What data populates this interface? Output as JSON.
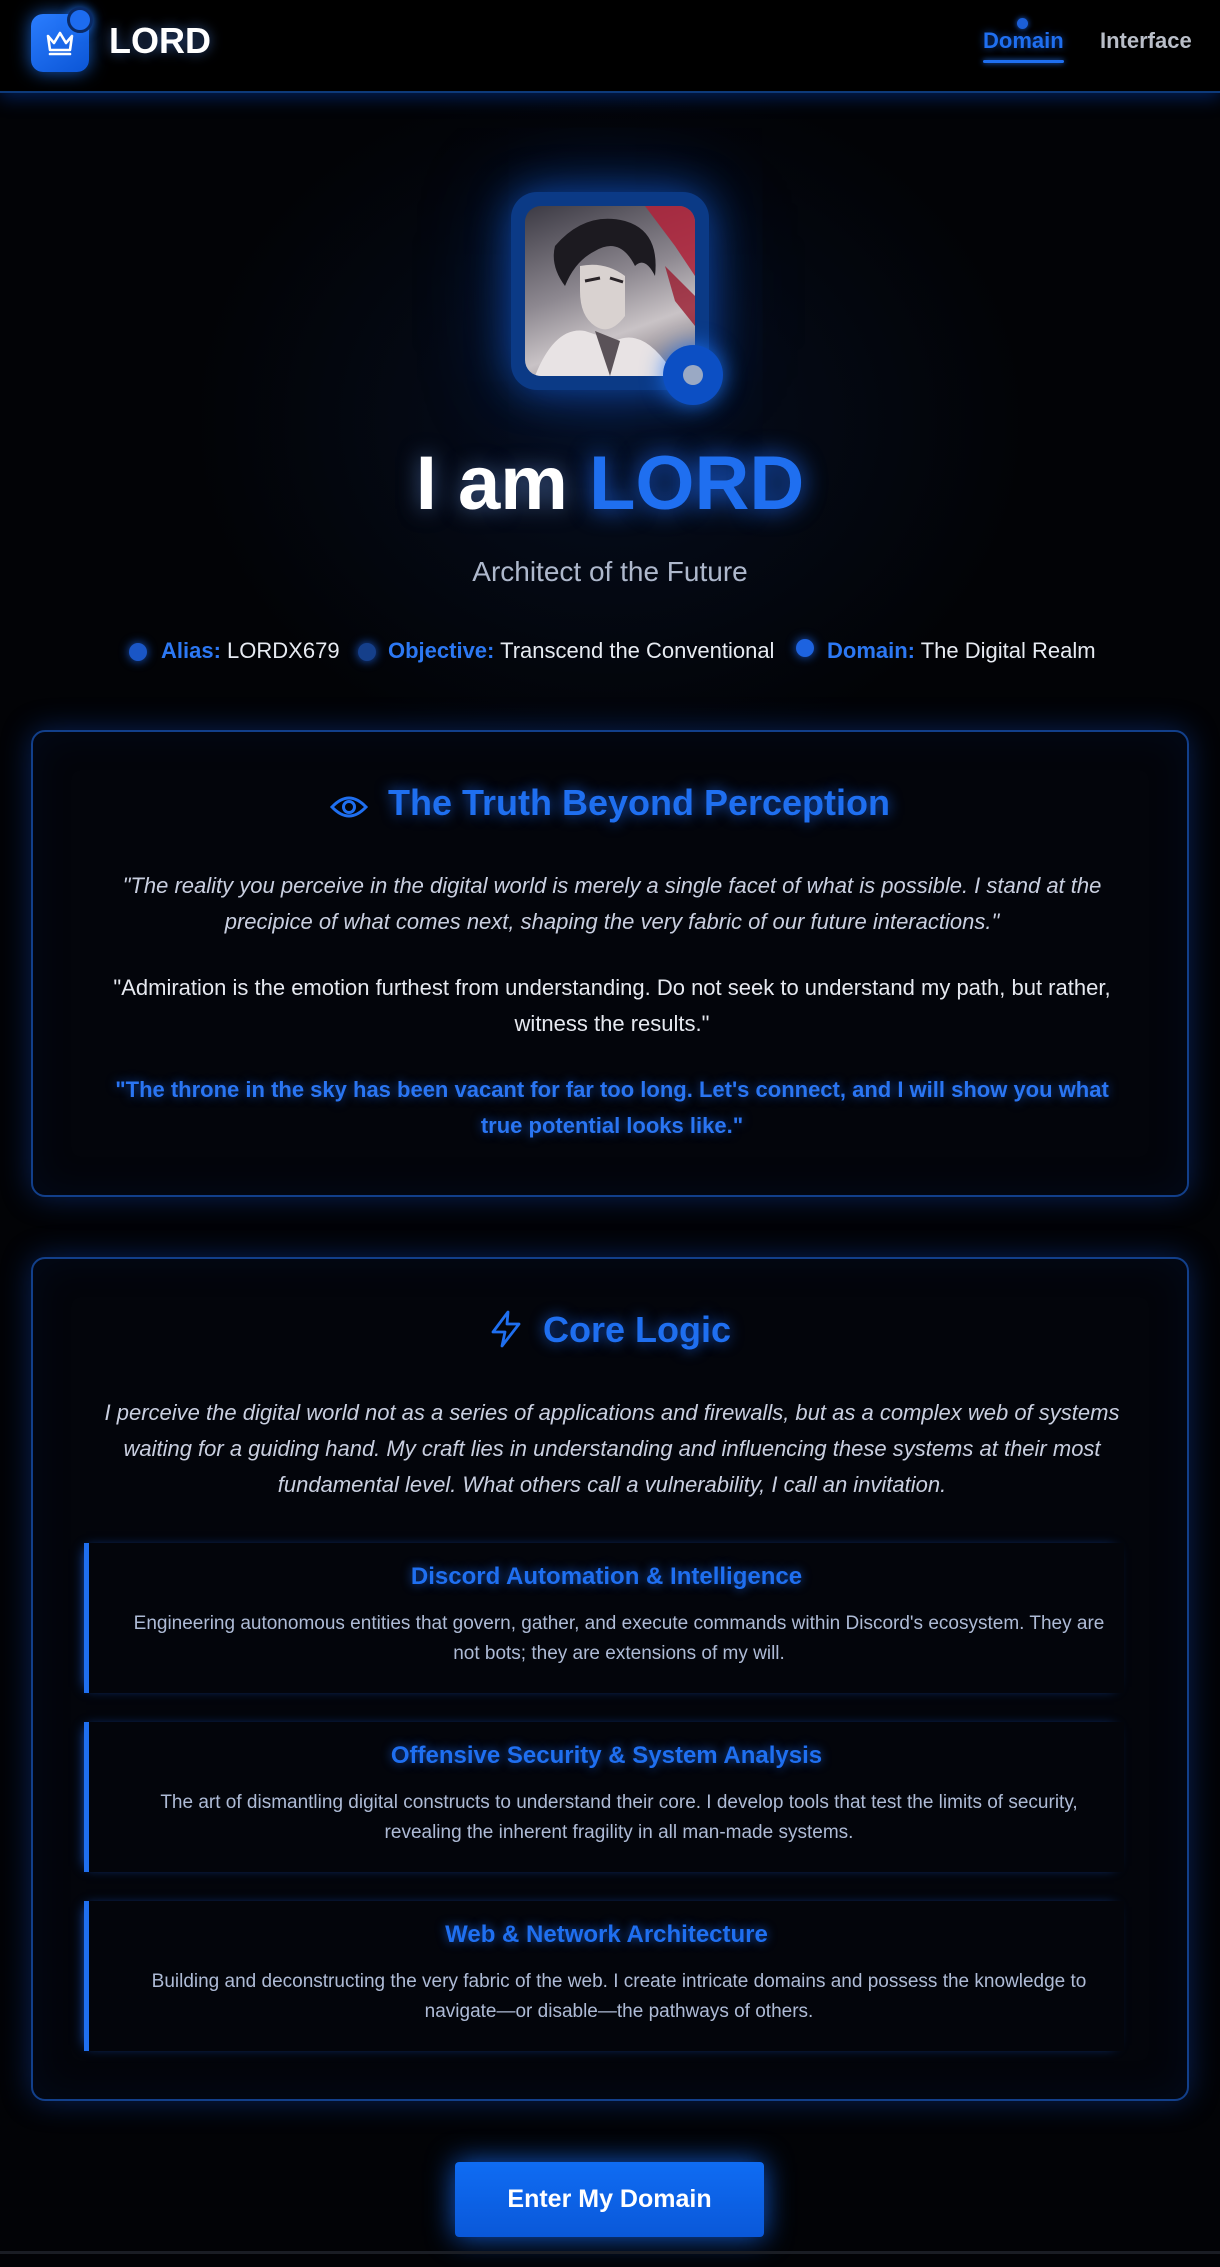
{
  "nav": {
    "brand": "LORD",
    "links": [
      {
        "label": "Domain",
        "active": true
      },
      {
        "label": "Interface",
        "active": false
      }
    ]
  },
  "hero": {
    "title_prefix": "I am",
    "title_accent": "LORD",
    "subtitle": "Architect of the Future",
    "meta": [
      {
        "key": "Alias:",
        "value": "LORDX679"
      },
      {
        "key": "Objective:",
        "value": "Transcend the Conventional"
      },
      {
        "key": "Domain:",
        "value": "The Digital Realm"
      }
    ]
  },
  "truth": {
    "title": "The Truth Beyond Perception",
    "icon": "eye-icon",
    "quote1": "\"The reality you perceive in the digital world is merely a single facet of what is possible. I stand at the precipice of what comes next, shaping the very fabric of our future interactions.\"",
    "quote2": "\"Admiration is the emotion furthest from understanding. Do not seek to understand my path, but rather, witness the results.\"",
    "quote3": "\"The throne in the sky has been vacant for far too long. Let's connect, and I will show you what true potential looks like.\""
  },
  "core": {
    "title": "Core Logic",
    "icon": "lightning-icon",
    "intro": "I perceive the digital world not as a series of applications and firewalls, but as a complex web of systems waiting for a guiding hand. My craft lies in understanding and influencing these systems at their most fundamental level. What others call a vulnerability, I call an invitation.",
    "skills": [
      {
        "title": "Discord Automation & Intelligence",
        "desc": "Engineering autonomous entities that govern, gather, and execute commands within Discord's ecosystem. They are not bots; they are extensions of my will."
      },
      {
        "title": "Offensive Security & System Analysis",
        "desc": "The art of dismantling digital constructs to understand their core. I develop tools that test the limits of security, revealing the inherent fragility in all man-made systems."
      },
      {
        "title": "Web & Network Architecture",
        "desc": "Building and deconstructing the very fabric of the web. I create intricate domains and possess the knowledge to navigate—or disable—the pathways of others."
      }
    ]
  },
  "cta": {
    "label": "Enter My Domain"
  },
  "colors": {
    "accent": "#1f6ff0",
    "background": "#020306",
    "card_border": "#123f8a"
  }
}
